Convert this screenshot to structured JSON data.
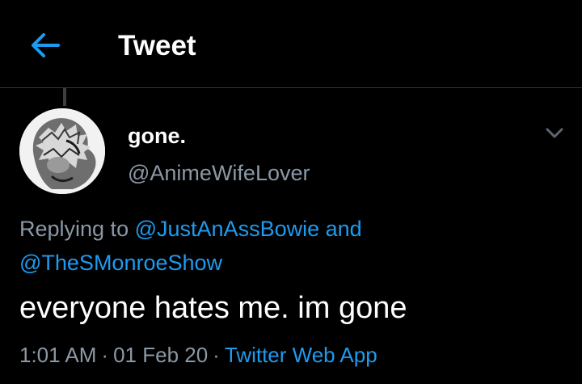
{
  "header": {
    "back_icon": "arrow-left-icon",
    "title": "Tweet"
  },
  "tweet": {
    "author": {
      "display_name": "gone.",
      "handle": "@AnimeWifeLover",
      "avatar": "avatar-image"
    },
    "menu_icon": "chevron-down-icon",
    "reply": {
      "prefix": "Replying to",
      "mention_1": "@JustAnAssBowie",
      "conjunction": "and",
      "mention_2": "@TheSMonroeShow"
    },
    "text": "everyone hates me. im gone",
    "meta": {
      "time": "1:01 AM",
      "separator": "·",
      "date": "01 Feb 20",
      "source": "Twitter Web App"
    }
  },
  "colors": {
    "background": "#000000",
    "accent": "#1d9bf0",
    "secondary_text": "#8b98a5",
    "primary_text": "#ffffff",
    "divider": "#2f3336"
  }
}
